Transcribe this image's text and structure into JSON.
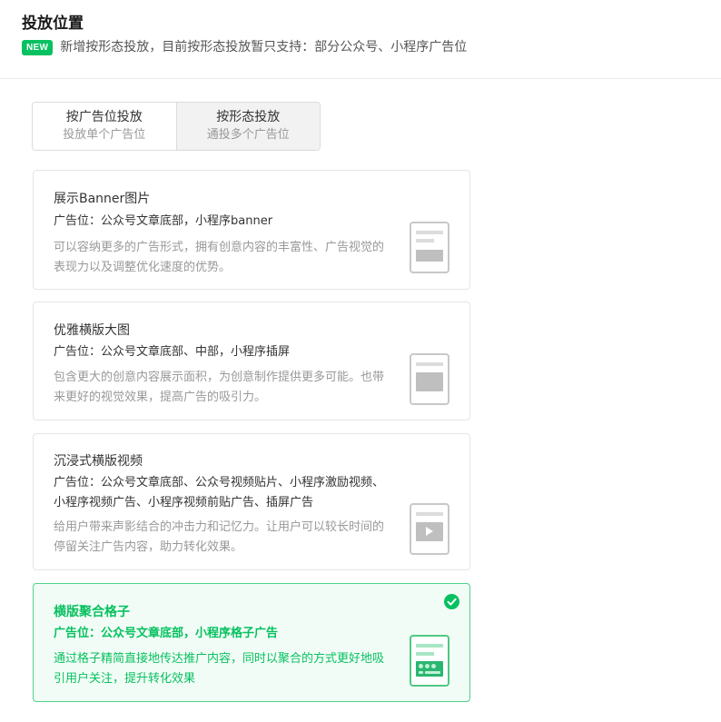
{
  "page": {
    "title": "投放位置",
    "notice_badge": "NEW",
    "notice_text": "新增按形态投放，目前按形态投放暂只支持：部分公众号、小程序广告位"
  },
  "tabs": [
    {
      "label": "按广告位投放",
      "sub": "投放单个广告位",
      "active": false
    },
    {
      "label": "按形态投放",
      "sub": "通投多个广告位",
      "active": true
    }
  ],
  "cards": [
    {
      "title": "展示Banner图片",
      "positions": "广告位：公众号文章底部，小程序banner",
      "description": "可以容纳更多的广告形式，拥有创意内容的丰富性、广告视觉的表现力以及调整优化速度的优势。",
      "icon": "banner-thumbnail-icon",
      "selected": false
    },
    {
      "title": "优雅横版大图",
      "positions": "广告位：公众号文章底部、中部，小程序插屏",
      "description": "包含更大的创意内容展示面积，为创意制作提供更多可能。也带来更好的视觉效果，提高广告的吸引力。",
      "icon": "large-image-thumbnail-icon",
      "selected": false
    },
    {
      "title": "沉浸式横版视频",
      "positions": "广告位：公众号文章底部、公众号视频贴片、小程序激励视频、小程序视频广告、小程序视频前贴广告、插屏广告",
      "description": "给用户带来声影结合的冲击力和记忆力。让用户可以较长时间的停留关注广告内容，助力转化效果。",
      "icon": "video-thumbnail-icon",
      "selected": false
    },
    {
      "title": "横版聚合格子",
      "positions": "广告位：公众号文章底部，小程序格子广告",
      "description": "通过格子精简直接地传达推广内容，同时以聚合的方式更好地吸引用户关注，提升转化效果",
      "icon": "grid-thumbnail-icon",
      "selected": true
    }
  ],
  "colors": {
    "accent": "#07c160",
    "selected_border": "#4dd38a",
    "selected_bg": "#f2fcf6",
    "muted_text": "#999999"
  }
}
